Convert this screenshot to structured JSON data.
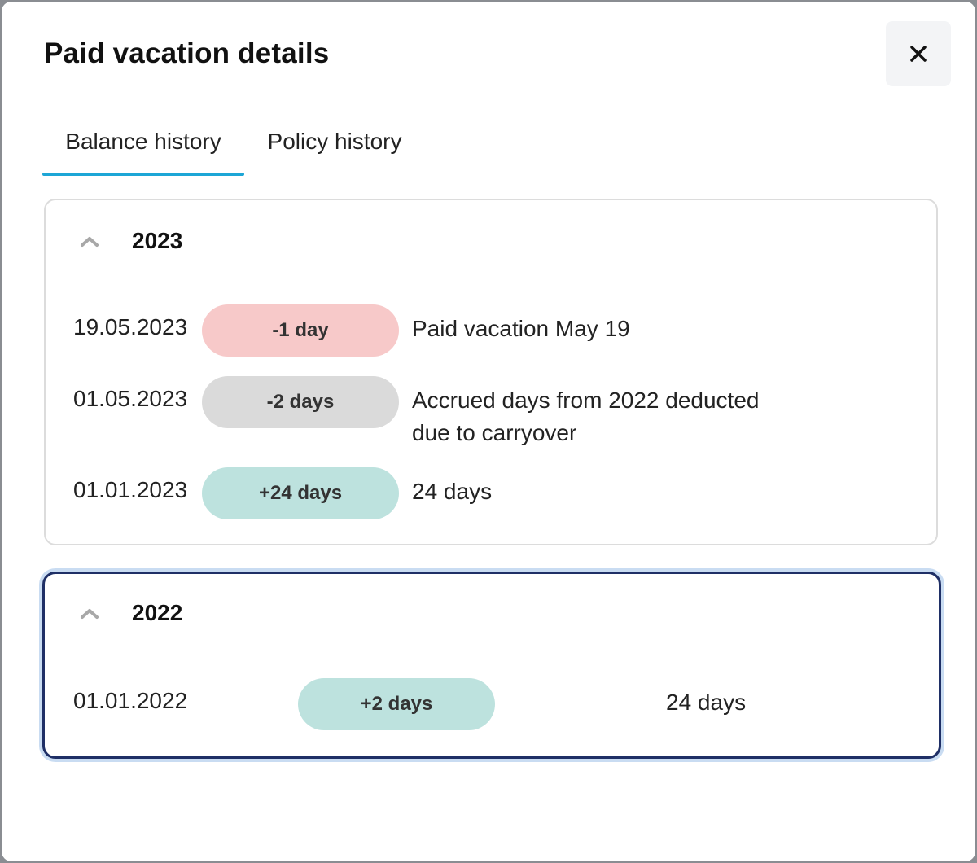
{
  "dialog": {
    "title": "Paid vacation details",
    "close_label": "×"
  },
  "tabs": [
    {
      "label": "Balance history",
      "active": true
    },
    {
      "label": "Policy history",
      "active": false
    }
  ],
  "years": [
    {
      "year": "2023",
      "expanded": true,
      "entries": [
        {
          "date": "19.05.2023",
          "change": "-1 day",
          "type": "deduction",
          "description": "Paid vacation May 19",
          "description_line2": ""
        },
        {
          "date": "01.05.2023",
          "change": "-2 days",
          "type": "adjustment",
          "description": "Accrued days from 2022 deducted",
          "description_line2": "due to carryover"
        },
        {
          "date": "01.01.2023",
          "change": "+24 days",
          "type": "accrual",
          "description": "24 days",
          "description_line2": ""
        }
      ]
    },
    {
      "year": "2022",
      "expanded": true,
      "entries": [
        {
          "date": "01.01.2022",
          "change": "+2 days",
          "type": "accrual",
          "description": "24 days",
          "description_line2": ""
        }
      ]
    }
  ],
  "colors": {
    "tab_underline": "#1da6d6",
    "deduction_pill": "#f7c9c9",
    "adjustment_pill": "#dadada",
    "accrual_pill": "#bde2de",
    "focus_border": "#1f2f66"
  }
}
